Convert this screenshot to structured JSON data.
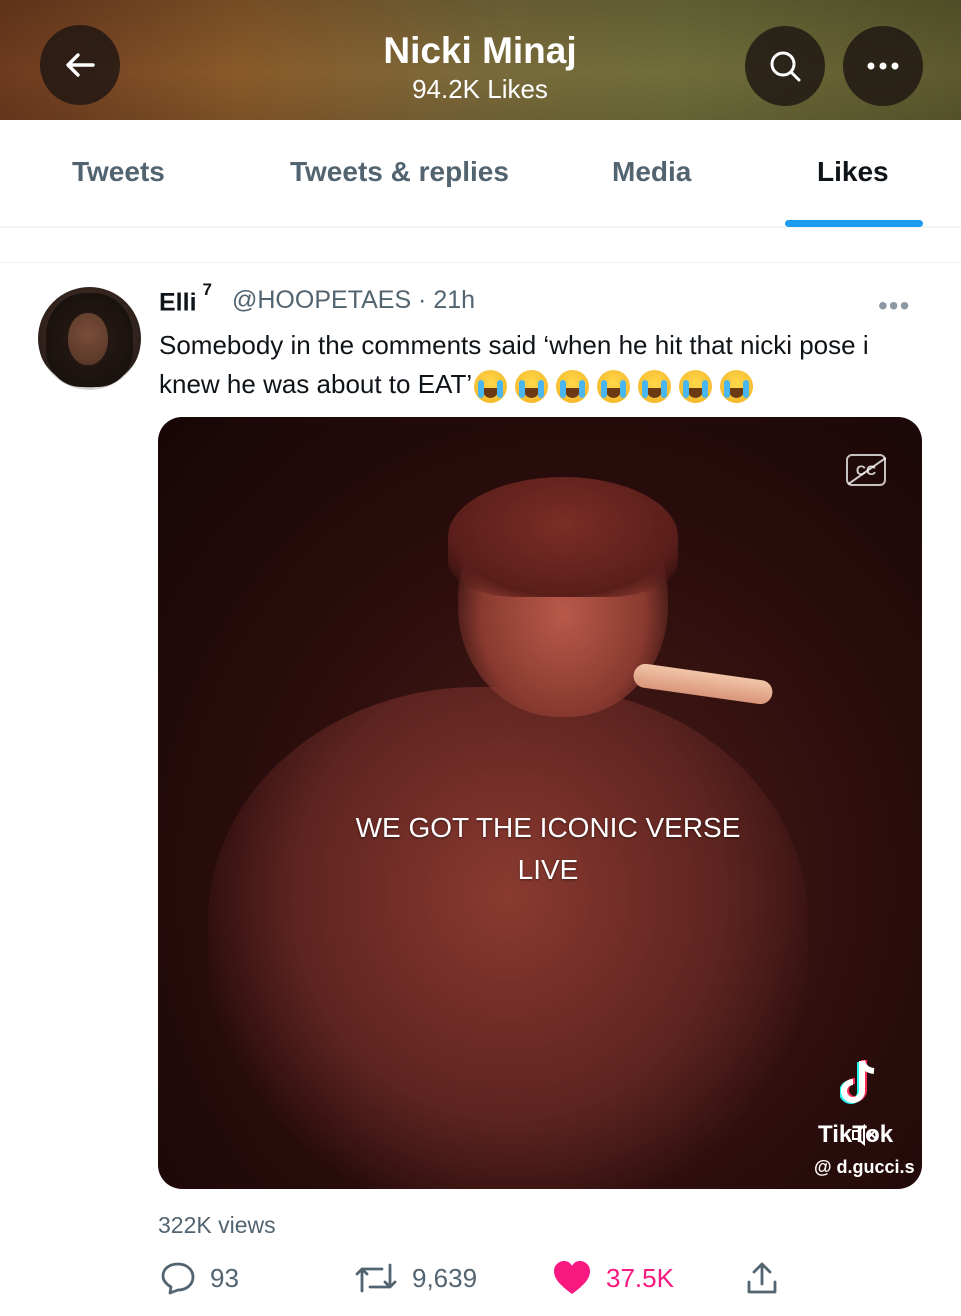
{
  "header": {
    "title": "Nicki Minaj",
    "subtitle": "94.2K Likes"
  },
  "tabs": [
    {
      "label": "Tweets",
      "active": false
    },
    {
      "label": "Tweets & replies",
      "active": false
    },
    {
      "label": "Media",
      "active": false
    },
    {
      "label": "Likes",
      "active": true
    }
  ],
  "tweet": {
    "name": "Elli",
    "name_superscript": "7",
    "handle_time": "@HOOPETAES · 21h",
    "more_label": "•••",
    "text": "Somebody in the comments said ‘when he hit that nicki pose i knew he was about to EAT’",
    "emoji_count": 7,
    "emoji_name": "loudly-crying-face",
    "media": {
      "caption": "WE GOT THE ICONIC VERSE LIVE",
      "cc_label": "CC",
      "watermark_brand": "TikTok",
      "watermark_handle": "@ d.gucci.s"
    },
    "views": "322K views",
    "stats": {
      "replies": "93",
      "retweets": "9,639",
      "likes": "37.5K"
    }
  },
  "colors": {
    "accent": "#1d9bf0",
    "like": "#f91880",
    "muted": "#536471"
  }
}
